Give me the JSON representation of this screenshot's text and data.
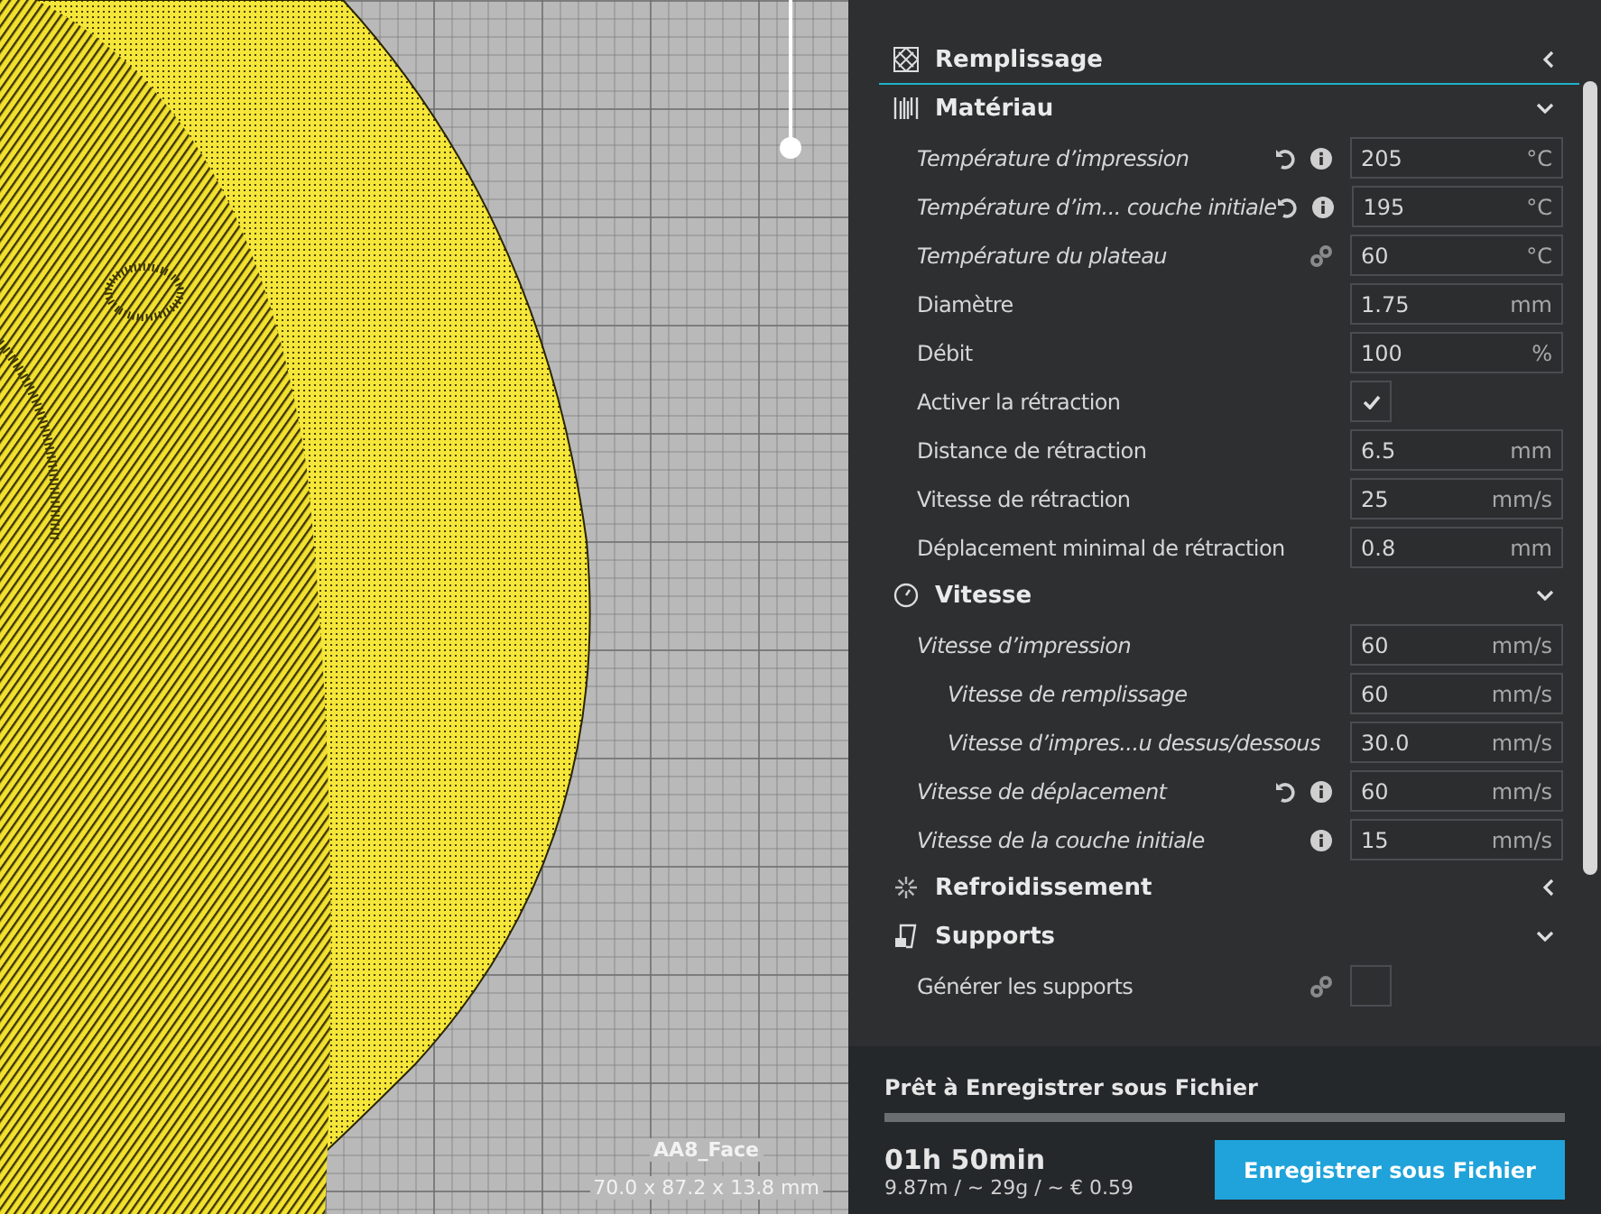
{
  "viewport": {
    "model_name": "AA8_Face",
    "model_size": "70.0 x 87.2 x 13.8 mm"
  },
  "sections": [
    {
      "kind": "infill",
      "title": "Remplissage",
      "expanded": false,
      "hovered": true
    },
    {
      "kind": "material",
      "title": "Matériau",
      "expanded": true,
      "hovered": false,
      "settings": [
        {
          "kind": "number",
          "label": "Température d’impression",
          "modified": true,
          "reset": true,
          "info": true,
          "linked": false,
          "value": "205",
          "unit": "°C"
        },
        {
          "kind": "number",
          "label": "Température d’im... couche initiale",
          "modified": true,
          "reset": true,
          "info": true,
          "linked": false,
          "value": "195",
          "unit": "°C"
        },
        {
          "kind": "number",
          "label": "Température du plateau",
          "modified": true,
          "reset": false,
          "info": false,
          "linked": true,
          "value": "60",
          "unit": "°C"
        },
        {
          "kind": "number",
          "label": "Diamètre",
          "modified": false,
          "reset": false,
          "info": false,
          "linked": false,
          "value": "1.75",
          "unit": "mm"
        },
        {
          "kind": "number",
          "label": "Débit",
          "modified": false,
          "reset": false,
          "info": false,
          "linked": false,
          "value": "100",
          "unit": "%"
        },
        {
          "kind": "checkbox",
          "label": "Activer la rétraction",
          "modified": false,
          "reset": false,
          "info": false,
          "linked": false,
          "checked": true
        },
        {
          "kind": "number",
          "label": "Distance de rétraction",
          "modified": false,
          "reset": false,
          "info": false,
          "linked": false,
          "value": "6.5",
          "unit": "mm"
        },
        {
          "kind": "number",
          "label": "Vitesse de rétraction",
          "modified": false,
          "reset": false,
          "info": false,
          "linked": false,
          "value": "25",
          "unit": "mm/s"
        },
        {
          "kind": "number",
          "label": "Déplacement minimal de rétraction",
          "modified": false,
          "reset": false,
          "info": false,
          "linked": false,
          "value": "0.8",
          "unit": "mm"
        }
      ]
    },
    {
      "kind": "speed",
      "title": "Vitesse",
      "expanded": true,
      "hovered": false,
      "settings": [
        {
          "kind": "number",
          "label": "Vitesse d’impression",
          "modified": true,
          "reset": false,
          "info": false,
          "linked": false,
          "value": "60",
          "unit": "mm/s",
          "children": [
            {
              "kind": "number",
              "label": "Vitesse de remplissage",
              "modified": true,
              "reset": false,
              "info": false,
              "linked": false,
              "value": "60",
              "unit": "mm/s"
            },
            {
              "kind": "number",
              "label": "Vitesse d’impres...u dessus/dessous",
              "modified": true,
              "reset": false,
              "info": false,
              "linked": false,
              "value": "30.0",
              "unit": "mm/s"
            }
          ]
        },
        {
          "kind": "number",
          "label": "Vitesse de déplacement",
          "modified": true,
          "reset": true,
          "info": true,
          "linked": false,
          "value": "60",
          "unit": "mm/s"
        },
        {
          "kind": "number",
          "label": "Vitesse de la couche initiale",
          "modified": true,
          "reset": false,
          "info": true,
          "linked": false,
          "value": "15",
          "unit": "mm/s"
        }
      ]
    },
    {
      "kind": "cooling",
      "title": "Refroidissement",
      "expanded": false,
      "hovered": false
    },
    {
      "kind": "support",
      "title": "Supports",
      "expanded": true,
      "hovered": false,
      "settings": [
        {
          "kind": "checkbox",
          "label": "Générer les supports",
          "modified": false,
          "reset": false,
          "info": false,
          "linked": true,
          "checked": false
        }
      ]
    }
  ],
  "output": {
    "status": "Prêt à Enregistrer sous Fichier",
    "level": 1,
    "time": "01h 50min",
    "details": "9.87m / ~ 29g / ~ € 0.59",
    "button": "Enregistrer sous Fichier"
  }
}
